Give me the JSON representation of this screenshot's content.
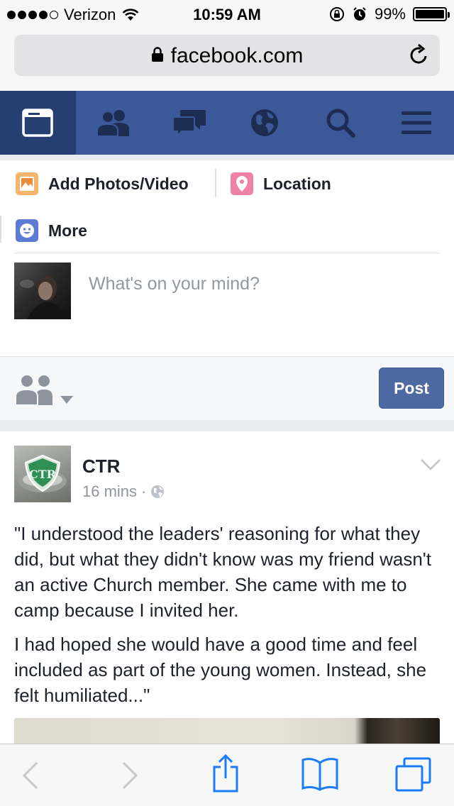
{
  "status_bar": {
    "carrier": "Verizon",
    "time": "10:59 AM",
    "battery": "99%",
    "signal_bars_filled": 4,
    "signal_bars_total": 5
  },
  "browser": {
    "url": "facebook.com"
  },
  "fb_nav": {
    "items": [
      {
        "name": "news-feed-icon",
        "active": true
      },
      {
        "name": "friends-icon",
        "active": false
      },
      {
        "name": "messages-icon",
        "active": false
      },
      {
        "name": "notifications-globe-icon",
        "active": false
      },
      {
        "name": "search-icon",
        "active": false
      },
      {
        "name": "menu-icon",
        "active": false
      }
    ]
  },
  "composer": {
    "add_photos_label": "Add Photos/Video",
    "location_label": "Location",
    "more_label": "More",
    "placeholder": "What's on your mind?",
    "post_button": "Post"
  },
  "story": {
    "page_name": "CTR",
    "time_ago": "16 mins",
    "separator": "·",
    "paragraphs": [
      "\"I understood the leaders' reasoning for what they did, but what they didn't know was my friend wasn't an active Church member. She came with me to camp because I invited her.",
      "I had hoped she would have a good time and feel included as part of the young women. Instead, she felt humiliated...\""
    ]
  },
  "colors": {
    "fb_blue": "#3b5998",
    "fb_blue_active": "#263f72",
    "ios_blue": "#1a7cf5",
    "post_button": "#4e69a2"
  }
}
